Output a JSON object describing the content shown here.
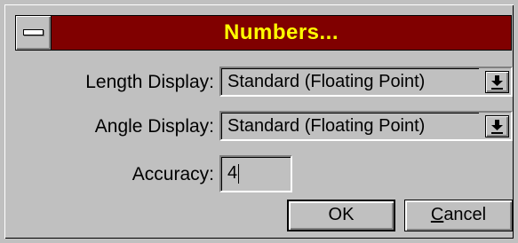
{
  "dialog": {
    "title": "Numbers...",
    "system_menu_icon": "system-menu-icon"
  },
  "fields": {
    "length_display": {
      "label": "Length Display:",
      "value": "Standard (Floating Point)",
      "dropdown_icon": "dropdown-arrow-icon"
    },
    "angle_display": {
      "label": "Angle Display:",
      "value": "Standard (Floating Point)",
      "dropdown_icon": "dropdown-arrow-icon"
    },
    "accuracy": {
      "label": "Accuracy:",
      "value": "4"
    }
  },
  "buttons": {
    "ok": "OK",
    "cancel_mnemonic": "C",
    "cancel_rest": "ancel"
  },
  "colors": {
    "titlebar": "#800000",
    "title_text": "#ffff00",
    "face": "#c0c0c0"
  }
}
